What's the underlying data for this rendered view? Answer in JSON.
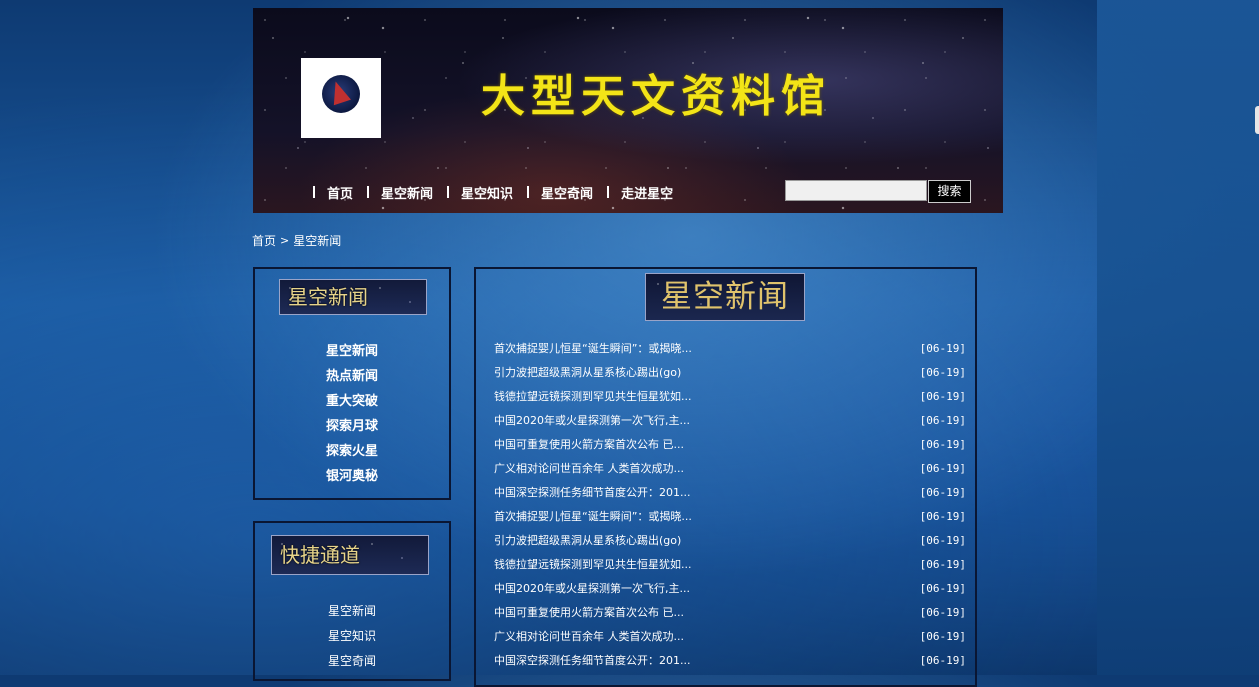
{
  "header": {
    "site_title": "大型天文资料馆",
    "nav": [
      "首页",
      "星空新闻",
      "星空知识",
      "星空奇闻",
      "走进星空"
    ],
    "search": {
      "value": "",
      "placeholder": "",
      "button_label": "搜索"
    }
  },
  "breadcrumb": {
    "home": "首页",
    "separator": ">",
    "current": "星空新闻"
  },
  "sidebar": {
    "category_box": {
      "title": "星空新闻",
      "items": [
        "星空新闻",
        "热点新闻",
        "重大突破",
        "探索月球",
        "探索火星",
        "银河奥秘"
      ]
    },
    "quick_box": {
      "title": "快捷通道",
      "items": [
        "星空新闻",
        "星空知识",
        "星空奇闻"
      ]
    }
  },
  "main": {
    "title": "星空新闻",
    "news": [
      {
        "title": "首次捕捉婴儿恒星“诞生瞬间”：或揭晓...",
        "date": "[06-19]"
      },
      {
        "title": "引力波把超级黑洞从星系核心踢出(go)",
        "date": "[06-19]"
      },
      {
        "title": "钱德拉望远镜探测到罕见共生恒星犹如...",
        "date": "[06-19]"
      },
      {
        "title": "中国2020年或火星探测第一次飞行,主...",
        "date": "[06-19]"
      },
      {
        "title": "中国可重复使用火箭方案首次公布 已...",
        "date": "[06-19]"
      },
      {
        "title": "广义相对论问世百余年 人类首次成功...",
        "date": "[06-19]"
      },
      {
        "title": "中国深空探测任务细节首度公开：201...",
        "date": "[06-19]"
      },
      {
        "title": "首次捕捉婴儿恒星“诞生瞬间”：或揭晓...",
        "date": "[06-19]"
      },
      {
        "title": "引力波把超级黑洞从星系核心踢出(go)",
        "date": "[06-19]"
      },
      {
        "title": "钱德拉望远镜探测到罕见共生恒星犹如...",
        "date": "[06-19]"
      },
      {
        "title": "中国2020年或火星探测第一次飞行,主...",
        "date": "[06-19]"
      },
      {
        "title": "中国可重复使用火箭方案首次公布 已...",
        "date": "[06-19]"
      },
      {
        "title": "广义相对论问世百余年 人类首次成功...",
        "date": "[06-19]"
      },
      {
        "title": "中国深空探测任务细节首度公开：201...",
        "date": "[06-19]"
      }
    ]
  },
  "colors": {
    "title_yellow": "#f3e417",
    "box_border": "#0a1633",
    "heading_gold": "#e0c36c"
  }
}
